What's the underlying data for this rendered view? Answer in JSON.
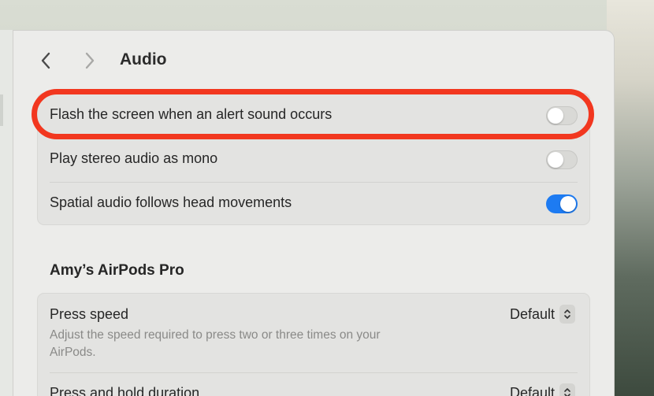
{
  "header": {
    "title": "Audio"
  },
  "audio_settings": {
    "items": [
      {
        "label": "Flash the screen when an alert sound occurs",
        "enabled": false
      },
      {
        "label": "Play stereo audio as mono",
        "enabled": false
      },
      {
        "label": "Spatial audio follows head movements",
        "enabled": true
      }
    ]
  },
  "airpods": {
    "section_title": "Amy’s AirPods Pro",
    "press_speed": {
      "label": "Press speed",
      "description": "Adjust the speed required to press two or three times on your AirPods.",
      "value": "Default"
    },
    "press_hold": {
      "label": "Press and hold duration",
      "value": "Default"
    }
  },
  "colors": {
    "accent": "#1d7bf2",
    "highlight_ring": "#f2371f"
  },
  "icons": {
    "back": "chevron-left-icon",
    "forward": "chevron-right-icon",
    "stepper": "up-down-chevron-icon"
  }
}
